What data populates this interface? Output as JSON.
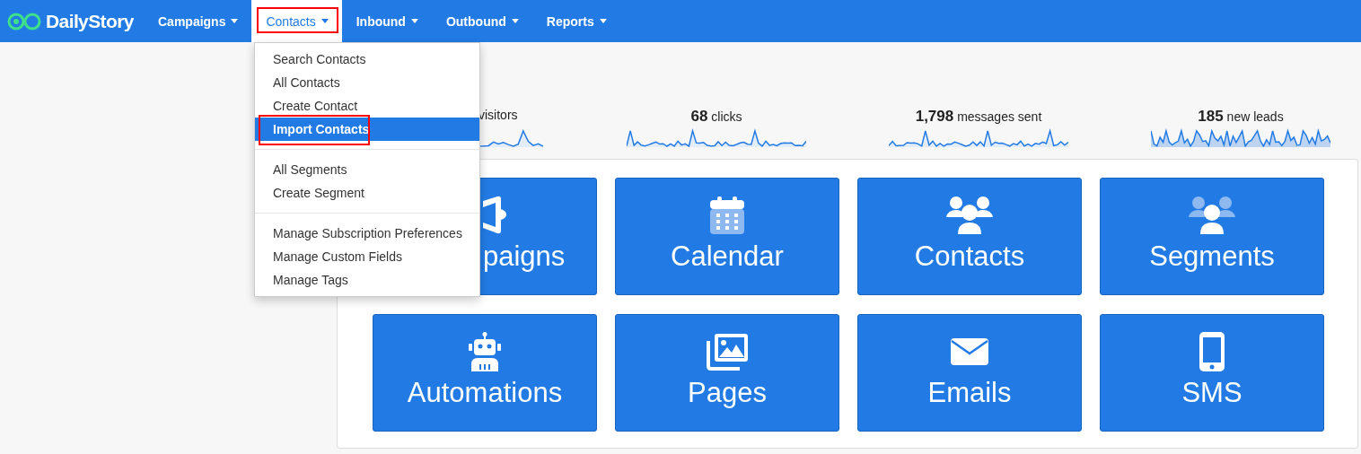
{
  "brand": {
    "name": "DailyStory"
  },
  "nav": [
    {
      "label": "Campaigns",
      "selected": false,
      "highlighted": false
    },
    {
      "label": "Contacts",
      "selected": true,
      "highlighted": true
    },
    {
      "label": "Inbound",
      "selected": false,
      "highlighted": false
    },
    {
      "label": "Outbound",
      "selected": false,
      "highlighted": false
    },
    {
      "label": "Reports",
      "selected": false,
      "highlighted": false
    }
  ],
  "dropdown": {
    "groups": [
      [
        {
          "label": "Search Contacts",
          "selected": false,
          "highlighted": false
        },
        {
          "label": "All Contacts",
          "selected": false,
          "highlighted": false
        },
        {
          "label": "Create Contact",
          "selected": false,
          "highlighted": false
        },
        {
          "label": "Import Contacts",
          "selected": true,
          "highlighted": true
        }
      ],
      [
        {
          "label": "All Segments",
          "selected": false,
          "highlighted": false
        },
        {
          "label": "Create Segment",
          "selected": false,
          "highlighted": false
        }
      ],
      [
        {
          "label": "Manage Subscription Preferences",
          "selected": false,
          "highlighted": false
        },
        {
          "label": "Manage Custom Fields",
          "selected": false,
          "highlighted": false
        },
        {
          "label": "Manage Tags",
          "selected": false,
          "highlighted": false
        }
      ]
    ]
  },
  "stats": [
    {
      "label": "visitors",
      "kind": "line"
    },
    {
      "value": "68",
      "label": "clicks",
      "kind": "line"
    },
    {
      "value": "1,798",
      "label": "messages sent",
      "kind": "line"
    },
    {
      "value": "185",
      "label": "new leads",
      "kind": "area"
    }
  ],
  "tiles": [
    {
      "label": "paigns",
      "kind": "megaphone"
    },
    {
      "label": "Calendar",
      "kind": "calendar"
    },
    {
      "label": "Contacts",
      "kind": "users"
    },
    {
      "label": "Segments",
      "kind": "segments"
    },
    {
      "label": "Automations",
      "kind": "robot"
    },
    {
      "label": "Pages",
      "kind": "images"
    },
    {
      "label": "Emails",
      "kind": "envelope"
    },
    {
      "label": "SMS",
      "kind": "phone"
    }
  ]
}
